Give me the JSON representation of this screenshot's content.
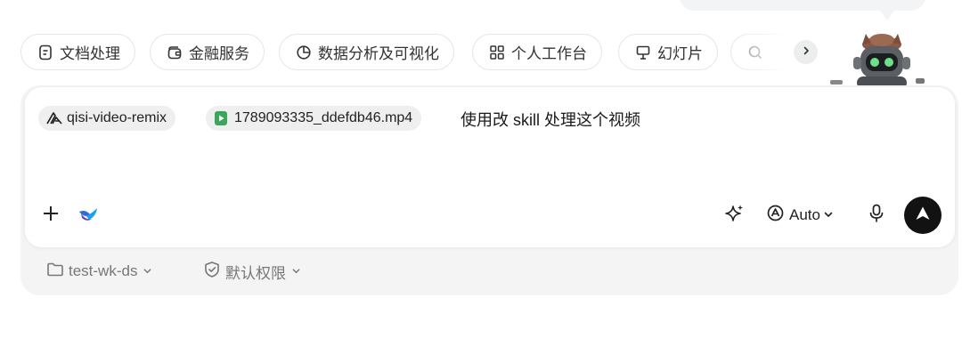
{
  "categories": [
    {
      "label": "文档处理",
      "icon": "document-icon"
    },
    {
      "label": "金融服务",
      "icon": "wallet-icon"
    },
    {
      "label": "数据分析及可视化",
      "icon": "pie-chart-icon"
    },
    {
      "label": "个人工作台",
      "icon": "grid-icon"
    },
    {
      "label": "幻灯片",
      "icon": "presentation-icon"
    },
    {
      "label": "",
      "icon": "search-icon"
    }
  ],
  "composer": {
    "skill_tag": "qisi-video-remix",
    "file_tag": "1789093335_ddefdb46.mp4",
    "prompt": "使用改 skill 处理这个视频",
    "mode_label": "Auto"
  },
  "footer": {
    "workspace": "test-wk-ds",
    "permission": "默认权限"
  },
  "colors": {
    "send_button": "#121212",
    "file_icon": "#3aa85a",
    "tag_bg": "#efefef"
  }
}
